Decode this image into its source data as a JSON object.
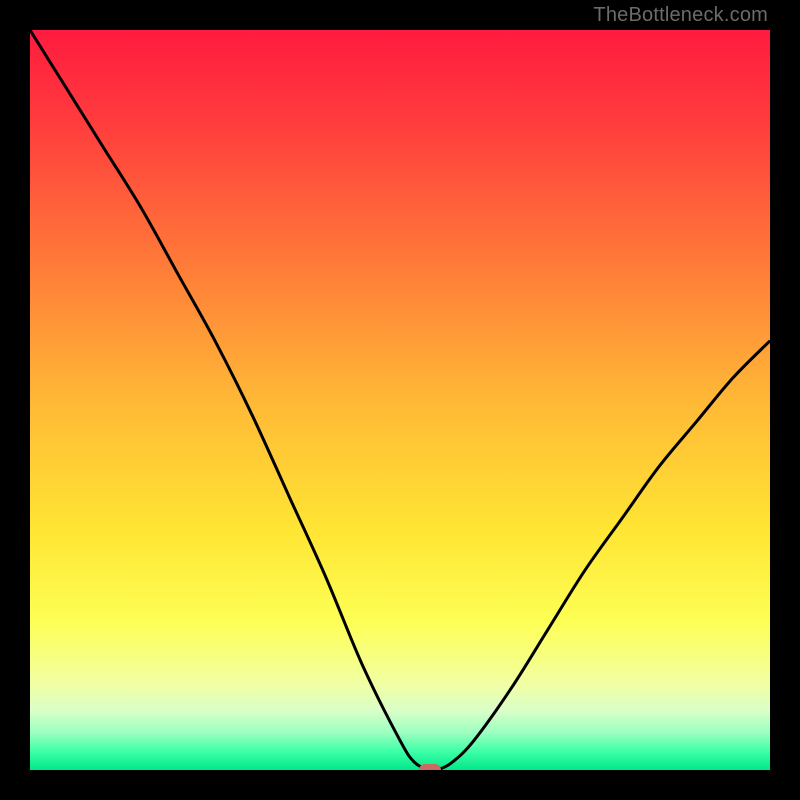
{
  "watermark": {
    "text": "TheBottleneck.com"
  },
  "chart_data": {
    "type": "line",
    "title": "",
    "xlabel": "",
    "ylabel": "",
    "xlim": [
      0,
      100
    ],
    "ylim": [
      0,
      100
    ],
    "x": [
      0,
      5,
      10,
      15,
      20,
      25,
      30,
      35,
      40,
      45,
      50,
      52,
      54,
      55,
      57,
      60,
      65,
      70,
      75,
      80,
      85,
      90,
      95,
      100
    ],
    "values": [
      100,
      92,
      84,
      76,
      67,
      58,
      48,
      37,
      26,
      14,
      4,
      1,
      0,
      0,
      1,
      4,
      11,
      19,
      27,
      34,
      41,
      47,
      53,
      58
    ],
    "gradient_stops": [
      {
        "offset": 0.0,
        "color": "#ff1b3f"
      },
      {
        "offset": 0.12,
        "color": "#ff3b3d"
      },
      {
        "offset": 0.3,
        "color": "#ff7539"
      },
      {
        "offset": 0.5,
        "color": "#ffb836"
      },
      {
        "offset": 0.68,
        "color": "#ffe634"
      },
      {
        "offset": 0.8,
        "color": "#fdff55"
      },
      {
        "offset": 0.88,
        "color": "#f3ffa0"
      },
      {
        "offset": 0.92,
        "color": "#d9ffc8"
      },
      {
        "offset": 0.95,
        "color": "#9affc0"
      },
      {
        "offset": 0.975,
        "color": "#3dffa6"
      },
      {
        "offset": 1.0,
        "color": "#00e88a"
      }
    ],
    "marker": {
      "x": 54,
      "y": 0,
      "color": "#c96a63"
    },
    "curve_stroke": "#000000",
    "curve_width": 3
  }
}
